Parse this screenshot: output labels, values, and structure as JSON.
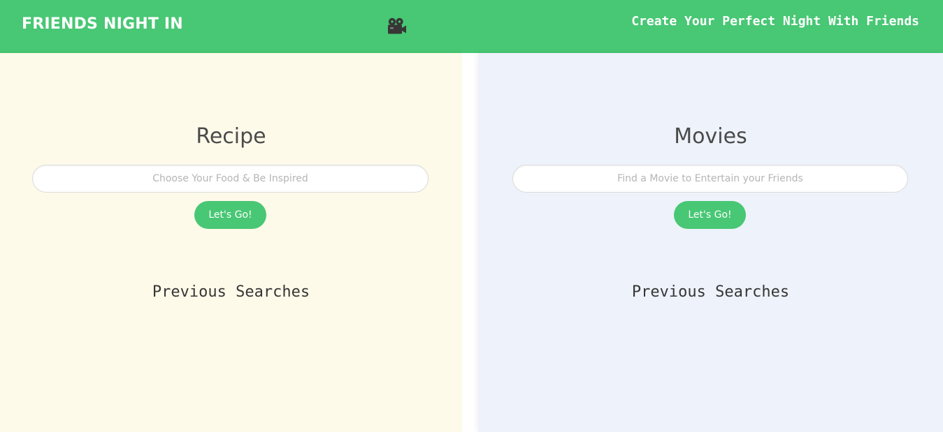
{
  "header": {
    "brand": "FRIENDS NIGHT IN",
    "icon": "film-camera-icon",
    "tagline": "Create Your Perfect Night With Friends"
  },
  "recipe": {
    "title": "Recipe",
    "search_placeholder": "Choose Your Food & Be Inspired",
    "search_value": "",
    "button_label": "Let's Go!",
    "previous_title": "Previous Searches",
    "previous_items": []
  },
  "movies": {
    "title": "Movies",
    "search_placeholder": "Find a Movie to Entertain your Friends",
    "search_value": "",
    "button_label": "Let's Go!",
    "previous_title": "Previous Searches",
    "previous_items": []
  },
  "colors": {
    "accent": "#48c774",
    "recipe_bg": "#fefae9",
    "movies_bg": "#eef2fa",
    "text": "#4a4a4a"
  }
}
